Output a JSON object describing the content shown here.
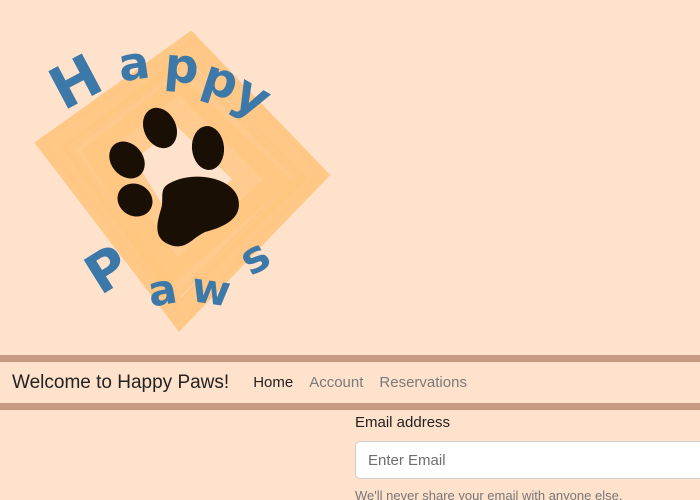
{
  "logo": {
    "word_top": "Happy",
    "word_bottom": "Paws",
    "text_color": "#3c78a8",
    "brush_color": "#ffc580",
    "paw_color": "#1a0f05"
  },
  "navbar": {
    "brand": "Welcome to Happy Paws!",
    "links": [
      {
        "label": "Home",
        "active": true
      },
      {
        "label": "Account",
        "active": false
      },
      {
        "label": "Reservations",
        "active": false
      }
    ]
  },
  "form": {
    "email_label": "Email address",
    "email_placeholder": "Enter Email",
    "email_help": "We'll never share your email with anyone else."
  },
  "colors": {
    "background": "#ffe2cc",
    "navbar_border": "#c79b83"
  }
}
